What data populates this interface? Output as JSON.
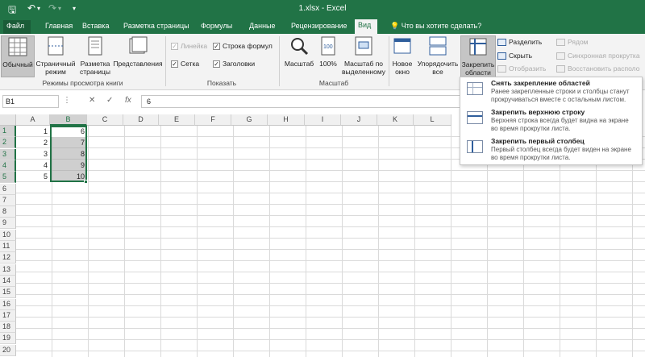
{
  "title": "1.xlsx - Excel",
  "qat": {
    "save": "🖫",
    "undo": "↶",
    "undo_dd": "▾",
    "redo": "↷",
    "redo_dd": "▾",
    "customize": "▾"
  },
  "tabs": [
    "Файл",
    "Главная",
    "Вставка",
    "Разметка страницы",
    "Формулы",
    "Данные",
    "Рецензирование",
    "Вид"
  ],
  "active_tab": "Вид",
  "tell_me": "Что вы хотите сделать?",
  "ribbon": {
    "views": {
      "normal": "Обычный",
      "page_break": "Страничный режим",
      "page_layout": "Разметка страницы",
      "custom": "Представления",
      "group": "Режимы просмотра книги"
    },
    "show": {
      "ruler": "Линейка",
      "formula_bar": "Строка формул",
      "gridlines": "Сетка",
      "headings": "Заголовки",
      "group": "Показать"
    },
    "zoom": {
      "zoom": "Масштаб",
      "hundred": "100%",
      "to_selection": "Масштаб по выделенному",
      "group": "Масштаб"
    },
    "window": {
      "new_window": "Новое окно",
      "arrange_all": "Упорядочить все",
      "freeze": "Закрепить области",
      "freeze_dd": "▾",
      "split": "Разделить",
      "hide": "Скрыть",
      "unhide": "Отобразить",
      "side_by_side": "Рядом",
      "sync_scroll": "Синхронная прокрутка",
      "reset_pos": "Восстановить располо"
    }
  },
  "formula_bar": {
    "name_box": "B1",
    "cancel": "✕",
    "enter": "✓",
    "fx": "fx",
    "value": "6"
  },
  "columns": [
    "A",
    "B",
    "C",
    "D",
    "E",
    "F",
    "G",
    "H",
    "I",
    "J",
    "K",
    "L"
  ],
  "rows": [
    "1",
    "2",
    "3",
    "4",
    "5",
    "6",
    "7",
    "8",
    "9",
    "10",
    "11",
    "12",
    "13",
    "14",
    "15",
    "16",
    "17",
    "18",
    "19",
    "20"
  ],
  "cells": {
    "A": [
      "1",
      "2",
      "3",
      "4",
      "5"
    ],
    "B": [
      "6",
      "7",
      "8",
      "9",
      "10"
    ]
  },
  "freeze_menu": [
    {
      "title": "Снять закрепление областей",
      "desc": "Ранее закрепленные строки и столбцы станут прокручиваться вместе с остальным листом."
    },
    {
      "title": "Закрепить верхнюю строку",
      "desc": "Верхняя строка всегда будет видна на экране во время прокрутки листа."
    },
    {
      "title": "Закрепить первый столбец",
      "desc": "Первый столбец всегда будет виден на экране во время прокрутки листа."
    }
  ],
  "colors": {
    "excel_green": "#217346",
    "selection": "#a0a0a0"
  }
}
